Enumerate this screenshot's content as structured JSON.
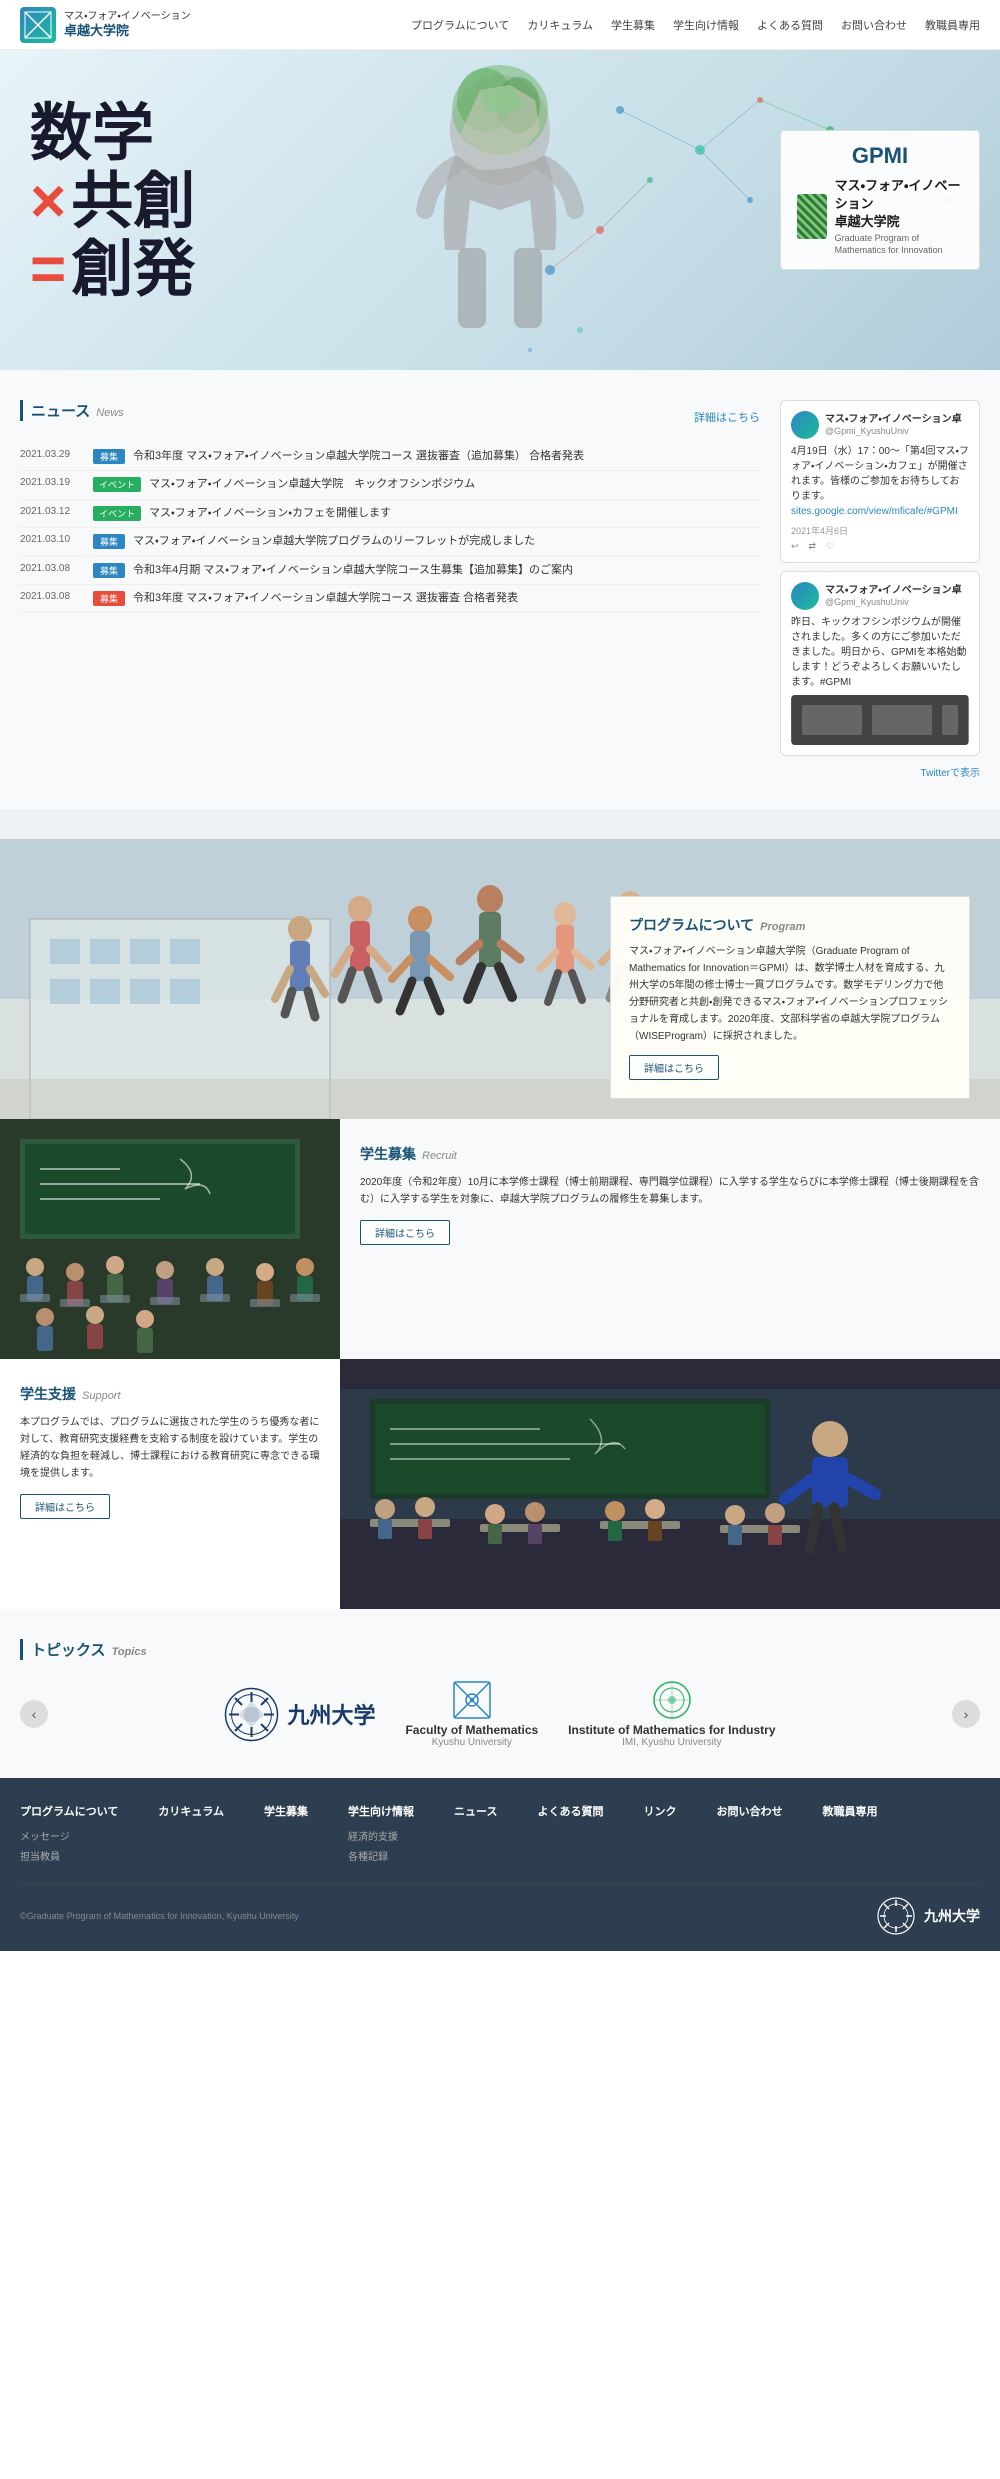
{
  "header": {
    "logo_line1": "マス・フォア・イノベーション",
    "logo_line2": "卓越大学院",
    "nav": [
      {
        "label": "プログラムについて",
        "id": "about"
      },
      {
        "label": "カリキュラム",
        "id": "curriculum"
      },
      {
        "label": "学生募集",
        "id": "recruit"
      },
      {
        "label": "学生向け情報",
        "id": "student-info"
      },
      {
        "label": "よくある質問",
        "id": "faq"
      },
      {
        "label": "お問い合わせ",
        "id": "contact"
      },
      {
        "label": "教職員専用",
        "id": "faculty"
      }
    ]
  },
  "hero": {
    "kanji_line1": "数学",
    "cross": "×",
    "kanji_line2": "共創",
    "eq": "=",
    "kanji_line3": "創発",
    "gpmi_title": "GPMI",
    "gpmi_org_main": "マス・フォア・イノベーション",
    "gpmi_org_sub2": "卓越大学院",
    "gpmi_org_en": "Graduate Program of Mathematics for Innovation"
  },
  "news": {
    "title": "ニュース",
    "title_en": "News",
    "detail_link": "詳細はこちら",
    "items": [
      {
        "date": "2021.03.29",
        "badge": "募集",
        "badge_type": "blue",
        "text": "令和3年度 マス・フォア・イノベーション卓越大学院コース 選抜審査（追加募集） 合格者発表"
      },
      {
        "date": "2021.03.19",
        "badge": "イベント",
        "badge_type": "green",
        "text": "マス・フォア・イノベーション卓越大学院　キックオフシンポジウム"
      },
      {
        "date": "2021.03.12",
        "badge": "イベント",
        "badge_type": "green",
        "text": "マス・フォア・イノベーション・カフェを開催します"
      },
      {
        "date": "2021.03.10",
        "badge": "募集",
        "badge_type": "blue",
        "text": "マス・フォア・イノベーション卓越大学院プログラムのリーフレットが完成しました"
      },
      {
        "date": "2021.03.08",
        "badge": "募集",
        "badge_type": "blue",
        "text": "令和3年4月期 マス・フォア・イノベーション卓越大学院コース生募集【追加募集】のご案内"
      },
      {
        "date": "2021.03.08",
        "badge": "募集",
        "badge_type": "red",
        "text": "令和3年度 マス・フォア・イノベーション卓越大学院コース 選抜審査 合格者発表"
      }
    ]
  },
  "twitter": {
    "tweets": [
      {
        "name": "マス・フォア・イノベーション卓",
        "handle": "@Gpmi_KyushuUniv",
        "text": "4月19日（水）17：00〜「第4回マス・フォア・イノベーション・カフェ」が開催されます。皆様のご参加をお待ちしております。",
        "link": "sites.google.com/view/mficafe/#GPMI",
        "date": "2021年4月6日",
        "has_actions": true
      },
      {
        "name": "マス・フォア・イノベーション卓",
        "handle": "@Gpmi_KyushuUniv",
        "text": "昨日、キックオフシンポジウムが開催されました。多くの方にご参加いただきました。明日から、GPMIを本格始動します！どうぞよろしくお願いいたします。#GPMI",
        "date": "",
        "has_image": true
      }
    ],
    "more_text": "Twitterで表示"
  },
  "program": {
    "title": "プログラムについて",
    "title_en": "Program",
    "description": "マス・フォア・イノベーション卓越大学院（Graduate Program of Mathematics for Innovation＝GPMI）は、数学博士人材を育成する、九州大学の5年間の修士博士一貫プログラムです。数学モデリング力で他分野研究者と共創・創発できるマス・フォア・イノベーションプロフェッショナルを育成します。2020年度、文部科学省の卓越大学院プログラム（WISEProgram）に採択されました。",
    "detail_btn": "詳細はこちら"
  },
  "recruit": {
    "title": "学生募集",
    "title_en": "Recruit",
    "description": "2020年度（令和2年度）10月に本学修士課程（博士前期課程、専門職学位課程）に入学する学生ならびに本学修士課程（博士後期課程を含む）に入学する学生を対象に、卓越大学院プログラムの履修生を募集します。",
    "detail_btn": "詳細はこちら"
  },
  "support": {
    "title": "学生支援",
    "title_en": "Support",
    "description": "本プログラムでは、プログラムに選抜された学生のうち優秀な者に対して、教育研究支援経費を支給する制度を設けています。学生の経済的な負担を軽減し、博士課程における教育研究に専念できる環境を提供します。",
    "detail_btn": "詳細はこちら"
  },
  "topics": {
    "title": "トピックス",
    "title_en": "Topics",
    "logos": [
      {
        "id": "kyushu",
        "name": "九州大学",
        "type": "kyushu"
      },
      {
        "id": "fac-math",
        "name": "Faculty of Mathematics",
        "subname": "Kyushu University",
        "type": "fac-math"
      },
      {
        "id": "inst-math",
        "name": "Institute of Mathematics for Industry",
        "subname": "IMI, Kyushu University",
        "type": "inst-math"
      }
    ]
  },
  "footer": {
    "cols": [
      {
        "title": "プログラムについて",
        "links": [
          "メッセージ",
          "担当教員"
        ]
      },
      {
        "title": "カリキュラム",
        "links": []
      },
      {
        "title": "学生募集",
        "links": []
      },
      {
        "title": "学生向け情報",
        "links": [
          "経済的支援",
          "各種記録"
        ]
      },
      {
        "title": "ニュース",
        "links": []
      },
      {
        "title": "よくある質問",
        "links": []
      },
      {
        "title": "リンク",
        "links": []
      },
      {
        "title": "お問い合わせ",
        "links": []
      },
      {
        "title": "教職員専用",
        "links": []
      }
    ],
    "copyright": "©Graduate Program of Mathematics for Innovation, Kyushu University"
  }
}
